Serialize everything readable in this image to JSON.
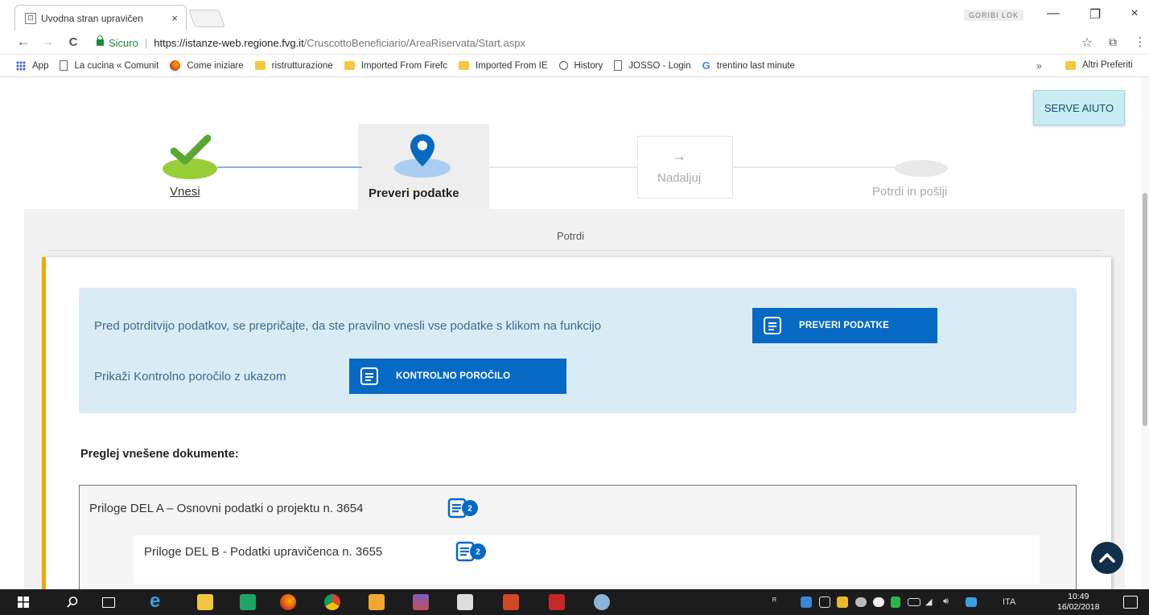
{
  "browser": {
    "tab_title": "Uvodna stran upravičen",
    "tab_close": "×",
    "profile_name": "GORIBI LOK",
    "window_min": "—",
    "window_max": "❐",
    "window_close": "×",
    "back": "←",
    "forward": "→",
    "reload": "C",
    "secure_label": "Sicuro",
    "url_host": "https://istanze-web.regione.fvg.it",
    "url_path": "/CruscottoBeneficiario/AreaRiservata/Start.aspx",
    "star": "☆",
    "cast": "⧉",
    "menu": "⋮"
  },
  "bookmarks": {
    "apps": "App",
    "items": [
      {
        "label": "La cucina « Comunit",
        "icon": "page-icon"
      },
      {
        "label": "Come iniziare",
        "icon": "firefox-icon"
      },
      {
        "label": "ristrutturazione",
        "icon": "folder-icon"
      },
      {
        "label": "Imported From Firefc",
        "icon": "folder-icon"
      },
      {
        "label": "Imported From IE",
        "icon": "folder-icon"
      },
      {
        "label": "History",
        "icon": "history-icon"
      },
      {
        "label": "JOSSO - Login",
        "icon": "page-icon"
      },
      {
        "label": "trentino last minute",
        "icon": "google-icon"
      }
    ],
    "more": "»",
    "other": "Altri Preferiti"
  },
  "help_button": "SERVE AIUTO",
  "steps": [
    {
      "label": "Vnesi",
      "state": "done"
    },
    {
      "label": "Preveri podatke",
      "state": "current"
    },
    {
      "label": "Nadaljuj",
      "state": "next",
      "arrow": "→"
    },
    {
      "label": "Potrdi in pošlji",
      "state": "pending"
    }
  ],
  "panel_title": "Potrdi",
  "info": {
    "line1": "Pred potrditvijo podatkov, se prepričajte, da ste pravilno vnesli vse podatke s klikom na funkcijo",
    "btn_check": "PREVERI PODATKE",
    "line2": "Prikaži Kontrolno poročilo z ukazom",
    "btn_report": "KONTROLNO POROČILO"
  },
  "documents_heading": "Preglej vnešene dokumente:",
  "documents": [
    {
      "label": "Priloge DEL A – Osnovni podatki o projektu n. 3654",
      "count": "2"
    },
    {
      "label": "Priloge DEL B - Podatki upravičenca n. 3655",
      "count": "2"
    }
  ],
  "taskbar": {
    "lang": "ITA",
    "time": "10:49",
    "date": "16/02/2018"
  },
  "colors": {
    "accent_blue": "#0669c4",
    "stripe": "#f3a600",
    "check_green": "#8dc63f"
  }
}
